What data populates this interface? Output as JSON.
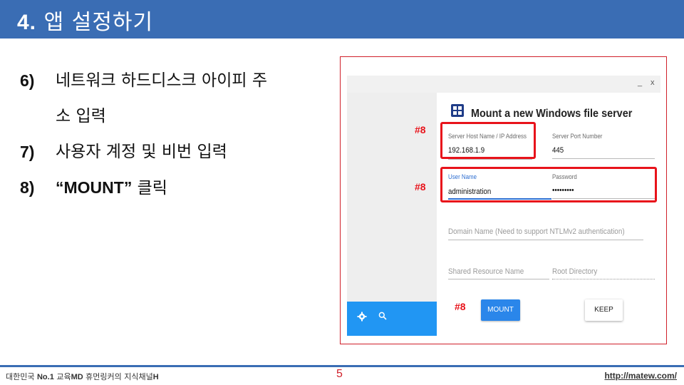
{
  "slide": {
    "title_num": "4.",
    "title_text": "앱 설정하기"
  },
  "steps": [
    {
      "num": "6)",
      "text": "네트워크 하드디스크 아이피 주",
      "continuation": "소 입력"
    },
    {
      "num": "7)",
      "text": "사용자 계정 및 비번 입력"
    },
    {
      "num": "8)",
      "quoted": "“MOUNT”",
      "text": " 클릭"
    }
  ],
  "app": {
    "window_controls": {
      "minimize": "_",
      "close": "x"
    },
    "heading": "Mount a new Windows file server",
    "fields": {
      "host_label": "Server Host Name / IP Address",
      "host_value": "192.168.1.9",
      "port_label": "Server Port Number",
      "port_value": "445",
      "user_label": "User Name",
      "user_value": "administration",
      "password_label": "Password",
      "password_value": "•••••••••",
      "domain_placeholder": "Domain Name (Need to support NTLMv2 authentication)",
      "shared_placeholder": "Shared Resource Name",
      "root_placeholder": "Root Directory"
    },
    "buttons": {
      "mount": "MOUNT",
      "keep": "KEEP"
    },
    "sidebar_icons": [
      "gear-icon",
      "search-icon"
    ],
    "markers": [
      "#8",
      "#8",
      "#8"
    ]
  },
  "footer": {
    "left_prefix": "대한민국 ",
    "left_bold": "No.1",
    "left_mid": " 교육",
    "left_bold2": "MD",
    "left_suffix": " 휴먼링커의 지식채널",
    "left_bold3": "H",
    "page": "5",
    "url": "http://matew.com/"
  },
  "colors": {
    "title_bar": "#3a6db4",
    "highlight": "#e8131b",
    "accent_blue": "#2a86ea",
    "sidebar_blue": "#2196f3"
  }
}
